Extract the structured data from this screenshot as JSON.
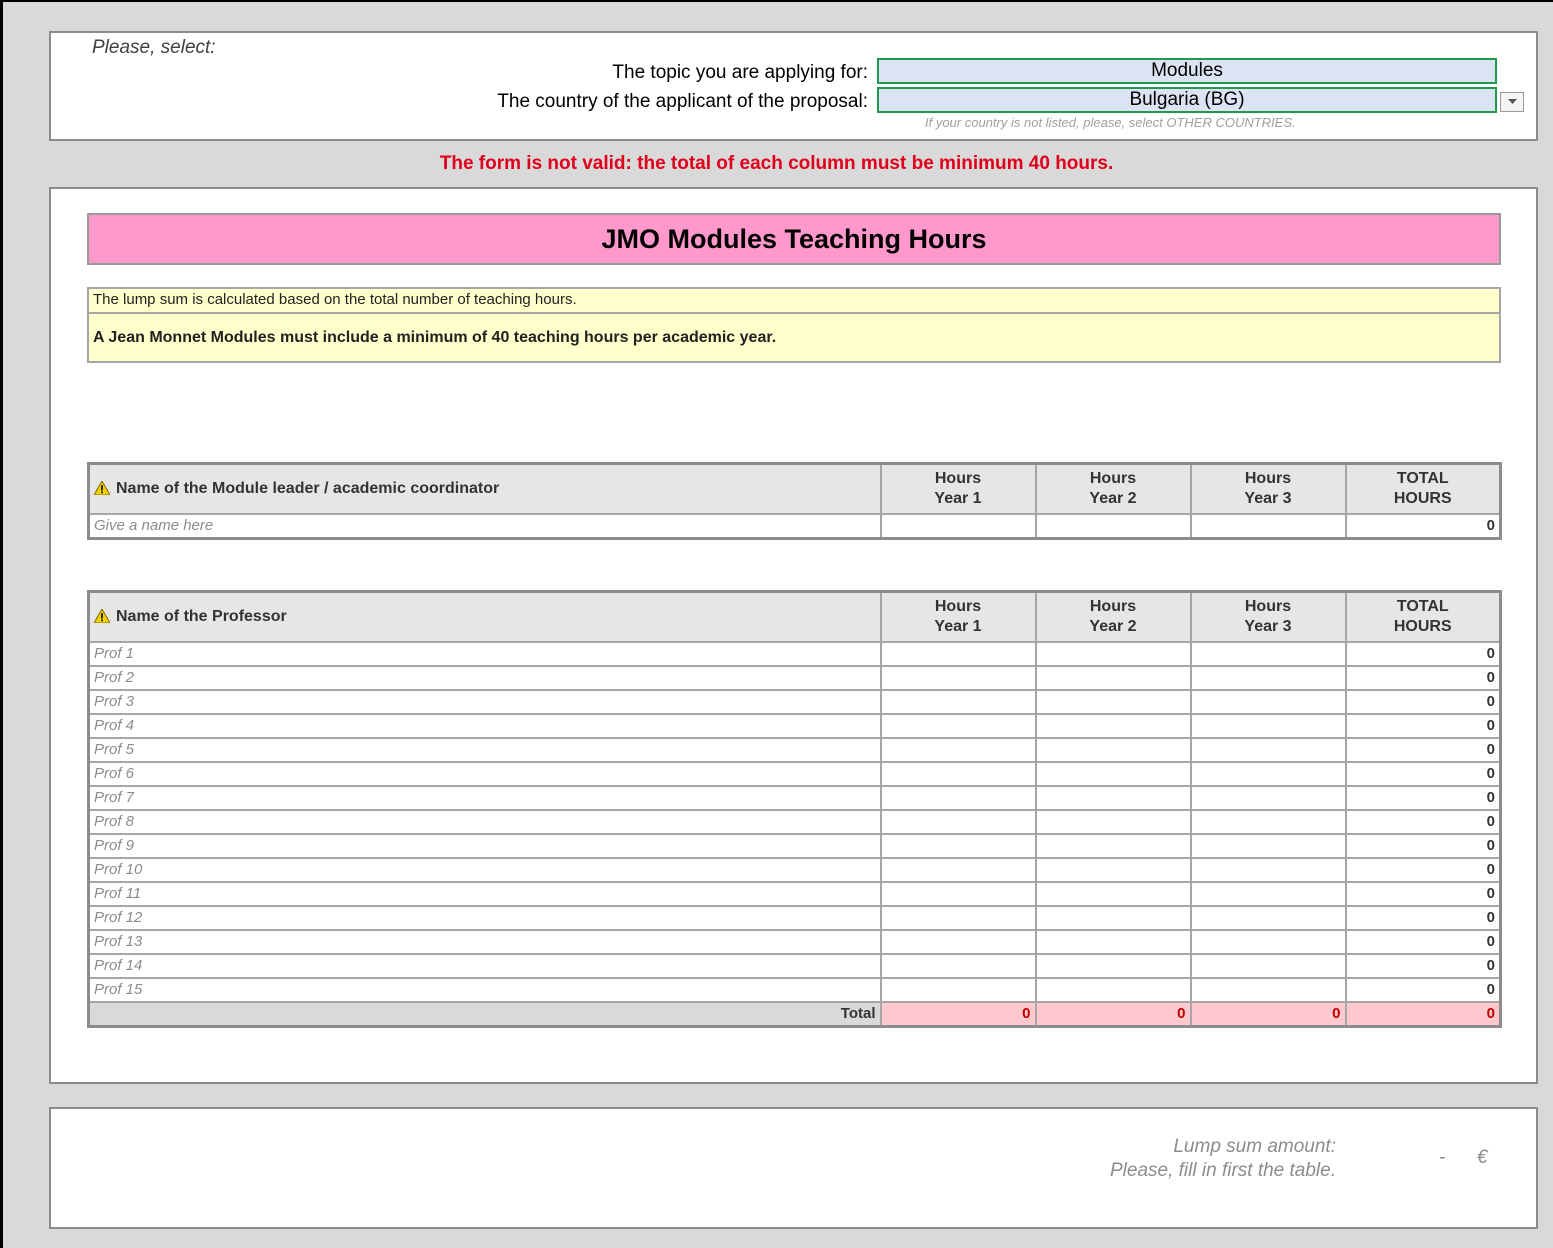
{
  "select_panel": {
    "prompt": "Please, select:",
    "topic_label": "The topic you are applying for:",
    "topic_value": "Modules",
    "country_label": "The country of the applicant of the proposal:",
    "country_value": "Bulgaria (BG)",
    "country_hint": "If your country is not listed, please, select OTHER COUNTRIES."
  },
  "validation_message": "The form is not valid: the total of each column must be minimum 40 hours.",
  "main": {
    "title": "JMO Modules Teaching Hours",
    "note_line1": "The lump sum is calculated based on the total number of teaching hours.",
    "note_line2": "A Jean Monnet Modules must include a minimum of 40 teaching hours per academic year."
  },
  "leader_table": {
    "name_header": "Name of the Module leader / academic coordinator",
    "col_year1": [
      "Hours",
      "Year 1"
    ],
    "col_year2": [
      "Hours",
      "Year 2"
    ],
    "col_year3": [
      "Hours",
      "Year 3"
    ],
    "col_total": [
      "TOTAL",
      "HOURS"
    ],
    "row": {
      "name": "Give a name here",
      "y1": "",
      "y2": "",
      "y3": "",
      "total": "0"
    }
  },
  "professor_table": {
    "name_header": "Name of the Professor",
    "col_year1": [
      "Hours",
      "Year 1"
    ],
    "col_year2": [
      "Hours",
      "Year 2"
    ],
    "col_year3": [
      "Hours",
      "Year 3"
    ],
    "col_total": [
      "TOTAL",
      "HOURS"
    ],
    "rows": [
      {
        "name": "Prof 1",
        "total": "0"
      },
      {
        "name": "Prof 2",
        "total": "0"
      },
      {
        "name": "Prof 3",
        "total": "0"
      },
      {
        "name": "Prof 4",
        "total": "0"
      },
      {
        "name": "Prof 5",
        "total": "0"
      },
      {
        "name": "Prof 6",
        "total": "0"
      },
      {
        "name": "Prof 7",
        "total": "0"
      },
      {
        "name": "Prof 8",
        "total": "0"
      },
      {
        "name": "Prof 9",
        "total": "0"
      },
      {
        "name": "Prof 10",
        "total": "0"
      },
      {
        "name": "Prof 11",
        "total": "0"
      },
      {
        "name": "Prof 12",
        "total": "0"
      },
      {
        "name": "Prof 13",
        "total": "0"
      },
      {
        "name": "Prof 14",
        "total": "0"
      },
      {
        "name": "Prof 15",
        "total": "0"
      }
    ],
    "total_label": "Total",
    "totals": {
      "y1": "0",
      "y2": "0",
      "y3": "0",
      "total": "0"
    }
  },
  "lump_sum": {
    "label": "Lump sum amount:",
    "sub_label": "Please, fill in first the table.",
    "value": "-",
    "currency": "€"
  },
  "colors": {
    "title_bg": "#ff99cc",
    "note_bg": "#ffffcc",
    "select_bg": "#dce3f2",
    "select_border": "#1f9a4a",
    "error_text": "#e0001b",
    "sum_bg": "#ffc7ce"
  },
  "icons": {
    "warning": "warning-icon",
    "dropdown": "chevron-down-icon"
  }
}
